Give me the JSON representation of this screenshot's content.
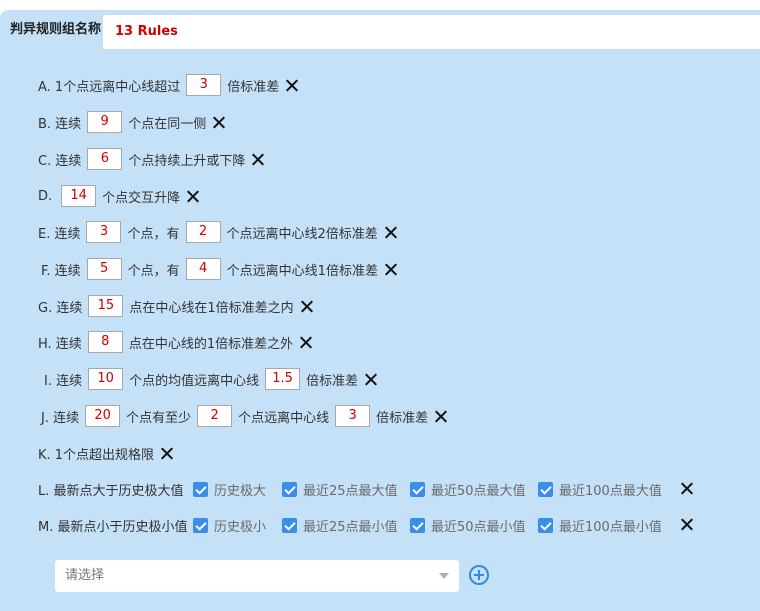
{
  "header": {
    "label": "判异规则组名称",
    "name_value": "13 Rules"
  },
  "rules": {
    "A": {
      "prefix": "A. 1个点远离中心线超过",
      "n1": "3",
      "suffix": "倍标准差"
    },
    "B": {
      "prefix": "B. 连续",
      "n1": "9",
      "suffix": "个点在同一侧"
    },
    "C": {
      "prefix": "C. 连续",
      "n1": "6",
      "suffix": "个点持续上升或下降"
    },
    "D": {
      "prefix": "D.",
      "n1": "14",
      "suffix": "个点交互升降"
    },
    "E": {
      "prefix": "E. 连续",
      "n1": "3",
      "mid": "个点，有",
      "n2": "2",
      "suffix": "个点远离中心线2倍标准差"
    },
    "F": {
      "prefix": "F. 连续",
      "n1": "5",
      "mid": "个点，有",
      "n2": "4",
      "suffix": "个点远离中心线1倍标准差"
    },
    "G": {
      "prefix": "G. 连续",
      "n1": "15",
      "suffix": "点在中心线在1倍标准差之内"
    },
    "H": {
      "prefix": "H. 连续",
      "n1": "8",
      "suffix": "点在中心线的1倍标准差之外"
    },
    "I": {
      "prefix": "I. 连续",
      "n1": "10",
      "mid": "个点的均值远离中心线",
      "n2": "1.5",
      "suffix": "倍标准差"
    },
    "J": {
      "prefix": "J. 连续",
      "n1": "20",
      "mid": "个点有至少",
      "n2": "2",
      "mid2": "个点远离中心线",
      "n3": "3",
      "suffix": "倍标准差"
    },
    "K": {
      "prefix": "K. 1个点超出规格限"
    },
    "L": {
      "prefix": "L. 最新点大于历史极大值",
      "options": [
        "历史极大",
        "最近25点最大值",
        "最近50点最大值",
        "最近100点最大值"
      ]
    },
    "M": {
      "prefix": "M. 最新点小于历史极小值",
      "options": [
        "历史极小",
        "最近25点最小值",
        "最近50点最小值",
        "最近100点最小值"
      ]
    }
  },
  "add_rule": {
    "placeholder": "请选择"
  },
  "colors": {
    "panel_bg": "#c5e1f8",
    "value_red": "#d00000",
    "checkbox_blue": "#3a8ee6",
    "add_icon_blue": "#2f8be0"
  }
}
